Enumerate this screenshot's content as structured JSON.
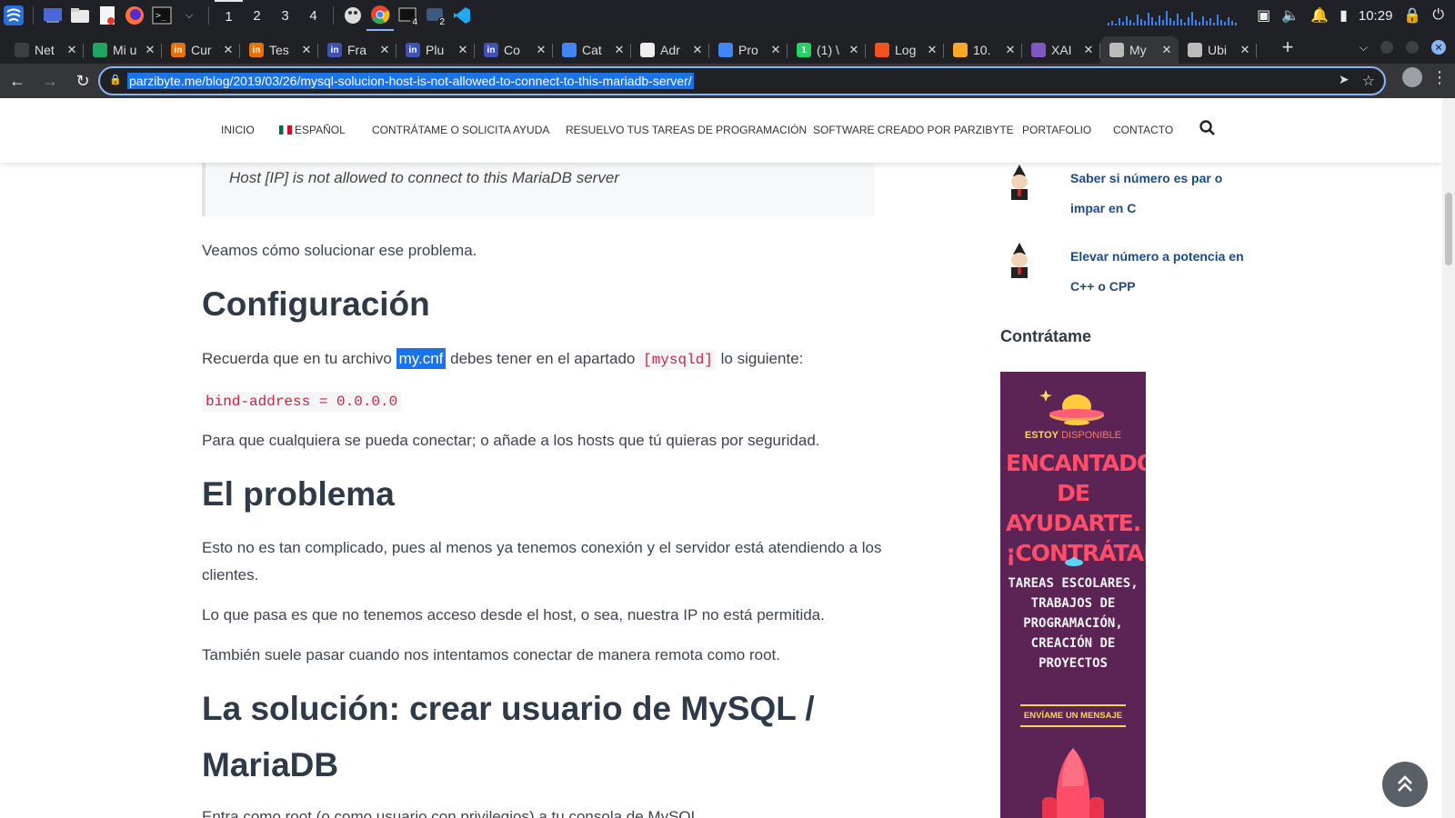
{
  "taskbar": {
    "workspaces": [
      "1",
      "2",
      "3",
      "4"
    ],
    "badges": [
      "4",
      "2"
    ],
    "clock": "10:29"
  },
  "tabs": [
    {
      "title": "Net",
      "fav_color": "#3c4043",
      "fav_label": ""
    },
    {
      "title": "Mi u",
      "fav_color": "#1fa463",
      "fav_label": ""
    },
    {
      "title": "Cur",
      "fav_color": "#e8710a",
      "fav_label": "in"
    },
    {
      "title": "Tes",
      "fav_color": "#e8710a",
      "fav_label": "in"
    },
    {
      "title": "Fra",
      "fav_color": "#3f51b5",
      "fav_label": "in"
    },
    {
      "title": "Plu",
      "fav_color": "#3f51b5",
      "fav_label": "in"
    },
    {
      "title": "Co",
      "fav_color": "#3f51b5",
      "fav_label": "in"
    },
    {
      "title": "Cat",
      "fav_color": "#4285f4",
      "fav_label": ""
    },
    {
      "title": "Adr",
      "fav_color": "#eeeeee",
      "fav_label": ""
    },
    {
      "title": "Pro",
      "fav_color": "#4285f4",
      "fav_label": ""
    },
    {
      "title": "(1) \\",
      "fav_color": "#25d366",
      "fav_label": "1"
    },
    {
      "title": "Log",
      "fav_color": "#f4511e",
      "fav_label": ""
    },
    {
      "title": "10.",
      "fav_color": "#f9a825",
      "fav_label": ""
    },
    {
      "title": "XAI",
      "fav_color": "#7e57c2",
      "fav_label": ""
    },
    {
      "title": "My",
      "fav_color": "#bbbbbb",
      "fav_label": "",
      "active": true
    },
    {
      "title": "Ubi",
      "fav_color": "#bbbbbb",
      "fav_label": ""
    }
  ],
  "toolbar": {
    "url": "parzibyte.me/blog/2019/03/26/mysql-solucion-host-is-not-allowed-to-connect-to-this-mariadb-server/"
  },
  "sitenav": {
    "items": [
      "INICIO",
      "ESPAÑOL",
      "CONTRÁTAME O SOLICITA AYUDA",
      "RESUELVO TUS TAREAS DE PROGRAMACIÓN",
      "SOFTWARE CREADO POR PARZIBYTE",
      "PORTAFOLIO",
      "CONTACTO"
    ]
  },
  "article": {
    "quote": "Host [IP] is not allowed to connect to this MariaDB server",
    "p1": "Veamos cómo solucionar ese problema.",
    "h_config": "Configuración",
    "p2_before": "Recuerda que en tu archivo",
    "p2_highlight": "my.cnf",
    "p2_mid": "debes tener en el apartado",
    "p2_code": "[mysqld]",
    "p2_after": "lo siguiente:",
    "code_line": "bind-address = 0.0.0.0",
    "p3": "Para que cualquiera se pueda conectar; o añade a los hosts que tú quieras por seguridad.",
    "h_problem": "El problema",
    "p4": "Esto no es tan complicado, pues al menos ya tenemos conexión y el servidor está atendiendo a los clientes.",
    "p5": "Lo que pasa es que no tenemos acceso desde el host, o sea, nuestra IP no está permitida.",
    "p6": "También suele pasar cuando nos intentamos conectar de manera remota como root.",
    "h_solution": "La solución: crear usuario de MySQL / MariaDB",
    "p7": "Entra como root (o como usuario con privilegios) a tu consola de MySQL."
  },
  "sidebar": {
    "posts": [
      "Saber si número es par o impar en C",
      "Elevar número a potencia en C++ o CPP"
    ],
    "hire_title": "Contrátame",
    "banner": {
      "available_1": "ESTOY",
      "available_2": "DISPONIBLE",
      "headline": "ENCANTADO DE AYUDARTE. ¡CONTRÁTAME!",
      "tasks": "TAREAS ESCOLARES, TRABAJOS DE PROGRAMACIÓN, CREACIÓN DE PROYECTOS",
      "cta": "ENVÍAME UN MENSAJE"
    }
  }
}
